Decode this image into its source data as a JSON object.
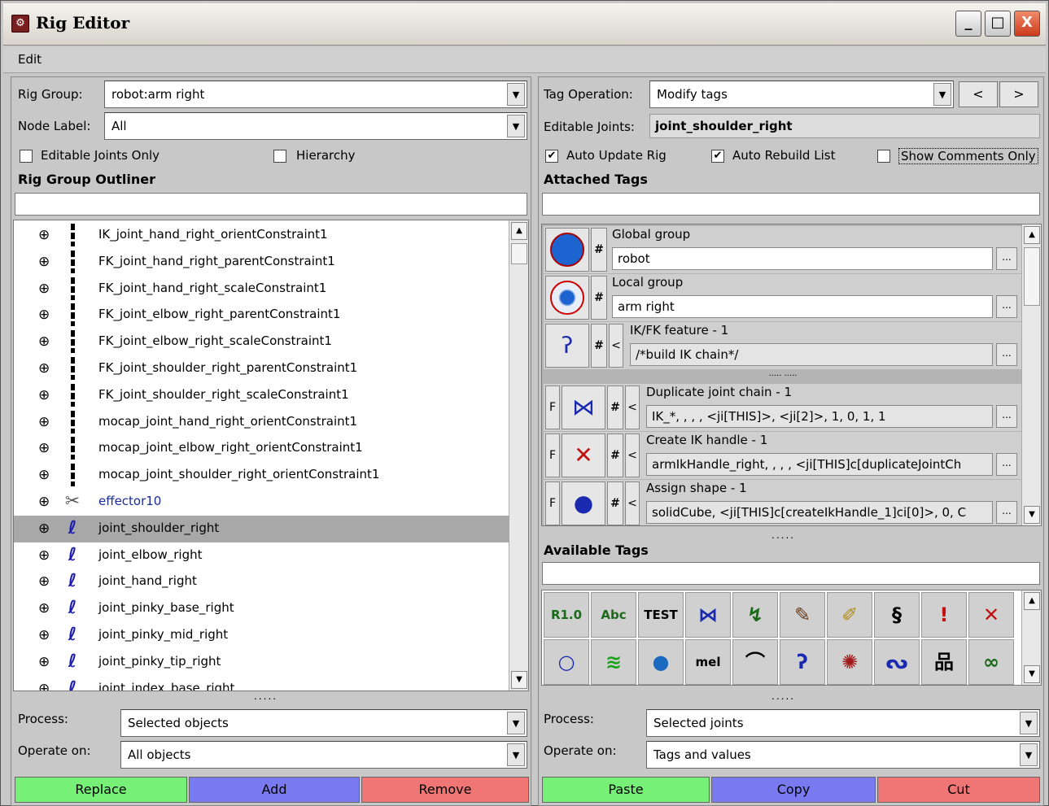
{
  "window": {
    "title": "Rig Editor",
    "app_icon": "rig-editor-icon",
    "minimize": "_",
    "maximize": "□",
    "close": "X"
  },
  "menu": {
    "edit": "Edit"
  },
  "left": {
    "rig_group_label": "Rig Group:",
    "rig_group_value": "robot:arm right",
    "node_label_label": "Node Label:",
    "node_label_value": "All",
    "editable_joints_only": "Editable Joints Only",
    "hierarchy": "Hierarchy",
    "outliner_title": "Rig Group Outliner",
    "rows": [
      {
        "name": "IK_joint_hand_right_orientConstraint1",
        "type": "constraint"
      },
      {
        "name": "FK_joint_hand_right_parentConstraint1",
        "type": "constraint"
      },
      {
        "name": "FK_joint_hand_right_scaleConstraint1",
        "type": "constraint"
      },
      {
        "name": "FK_joint_elbow_right_parentConstraint1",
        "type": "constraint"
      },
      {
        "name": "FK_joint_elbow_right_scaleConstraint1",
        "type": "constraint"
      },
      {
        "name": "FK_joint_shoulder_right_parentConstraint1",
        "type": "constraint"
      },
      {
        "name": "FK_joint_shoulder_right_scaleConstraint1",
        "type": "constraint"
      },
      {
        "name": "mocap_joint_hand_right_orientConstraint1",
        "type": "constraint"
      },
      {
        "name": "mocap_joint_elbow_right_orientConstraint1",
        "type": "constraint"
      },
      {
        "name": "mocap_joint_shoulder_right_orientConstraint1",
        "type": "constraint"
      },
      {
        "name": "effector10",
        "type": "effector"
      },
      {
        "name": "joint_shoulder_right",
        "type": "joint",
        "selected": true
      },
      {
        "name": "joint_elbow_right",
        "type": "joint"
      },
      {
        "name": "joint_hand_right",
        "type": "joint"
      },
      {
        "name": "joint_pinky_base_right",
        "type": "joint"
      },
      {
        "name": "joint_pinky_mid_right",
        "type": "joint"
      },
      {
        "name": "joint_pinky_tip_right",
        "type": "joint"
      },
      {
        "name": "joint_index_base_right",
        "type": "joint"
      }
    ],
    "splitter": ".....",
    "process_label": "Process:",
    "process_value": "Selected objects",
    "operate_label": "Operate on:",
    "operate_value": "All objects",
    "replace": "Replace",
    "add": "Add",
    "remove": "Remove"
  },
  "right": {
    "tag_operation_label": "Tag Operation:",
    "tag_operation_value": "Modify tags",
    "prev": "<",
    "next": ">",
    "editable_joints_label": "Editable Joints:",
    "editable_joints_value": "joint_shoulder_right",
    "auto_update_rig": "Auto Update Rig",
    "auto_rebuild_list": "Auto Rebuild List",
    "show_comments_only": "Show Comments Only",
    "attached_tags_title": "Attached Tags",
    "tags": [
      {
        "name": "Global group",
        "value": "robot",
        "flag": "",
        "icon": "global-group-icon"
      },
      {
        "name": "Local group",
        "value": "arm right",
        "flag": "",
        "icon": "local-group-icon"
      },
      {
        "name": "IK/FK feature - 1",
        "value": "/*build IK chain*/",
        "flag": "",
        "icon": "ikfk-feature-icon"
      },
      {
        "name": "Duplicate joint chain - 1",
        "value": "IK_*, , , , <ji[THIS]>, <ji[2]>, 1, 0, 1, 1",
        "flag": "F",
        "icon": "duplicate-chain-icon"
      },
      {
        "name": "Create IK handle - 1",
        "value": "armIkHandle_right, , , , <ji[THIS]c[duplicateJointCh",
        "flag": "F",
        "icon": "ik-handle-icon"
      },
      {
        "name": "Assign shape - 1",
        "value": "solidCube, <ji[THIS]c[createIkHandle_1]ci[0]>, 0, C",
        "flag": "F",
        "icon": "assign-shape-icon"
      }
    ],
    "hash": "#",
    "lt": "<",
    "ellipsis": "...",
    "inner_splitter": "..... .....",
    "splitter": ".....",
    "available_tags_title": "Available Tags",
    "palette": [
      "R1.0",
      "Abc",
      "TEST",
      "⋈",
      "↯",
      "✎",
      "✐",
      "§",
      "!",
      "✕",
      "○",
      "≋",
      "●",
      "mel",
      "⌒",
      "ʔ",
      "✺",
      "ᔓ",
      "品",
      "∞"
    ],
    "process_label": "Process:",
    "process_value": "Selected joints",
    "operate_label": "Operate on:",
    "operate_value": "Tags and values",
    "paste": "Paste",
    "copy": "Copy",
    "cut": "Cut"
  }
}
